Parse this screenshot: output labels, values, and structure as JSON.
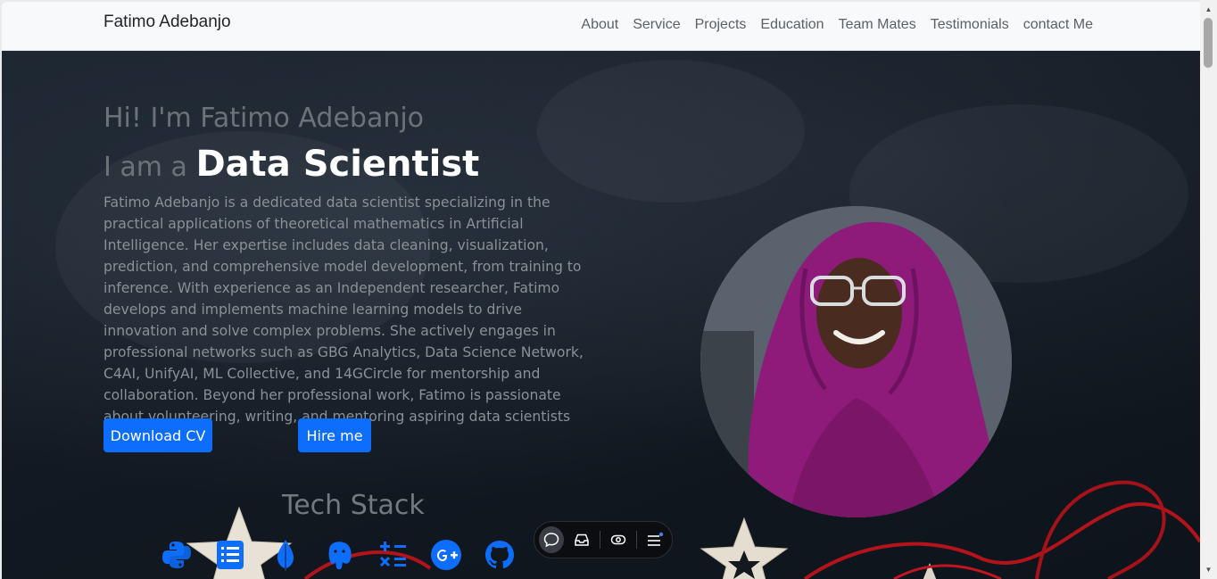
{
  "navbar": {
    "brand": "Fatimo Adebanjo",
    "links": [
      "About",
      "Service",
      "Projects",
      "Education",
      "Team Mates",
      "Testimonials",
      "contact Me"
    ]
  },
  "hero": {
    "greeting": "Hi! I'm Fatimo Adebanjo",
    "role_prefix": "I am a ",
    "role": "Data Scientist",
    "bio": "Fatimo Adebanjo is a dedicated data scientist specializing in the practical applications of theoretical mathematics in Artificial Intelligence. Her expertise includes data cleaning, visualization, prediction, and comprehensive model development, from training to inference. With experience as an Independent researcher, Fatimo develops and implements machine learning models to drive innovation and solve complex problems. She actively engages in professional networks such as GBG Analytics, Data Science Network, C4AI, UnifyAI, ML Collective, and 14GCircle for mentorship and collaboration. Beyond her professional work, Fatimo is passionate about volunteering, writing, and mentoring aspiring data scientists",
    "download_cv": "Download CV",
    "hire_me": "Hire me"
  },
  "tech_stack": {
    "title": "Tech Stack",
    "icons": [
      "python-icon",
      "list-icon",
      "mongodb-leaf-icon",
      "postgresql-icon",
      "calculator-icon",
      "google-plus-icon",
      "github-icon"
    ]
  },
  "toolbar": {
    "icons": [
      "chat-icon",
      "inbox-icon",
      "eye-icon",
      "menu-icon"
    ]
  },
  "colors": {
    "primary": "#0d6efd",
    "hero_bg": "#121922",
    "hijab": "#8e1b7a"
  }
}
